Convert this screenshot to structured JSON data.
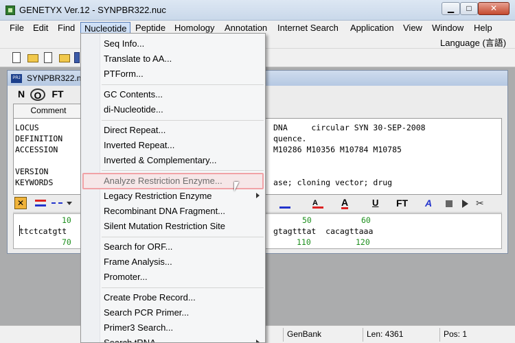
{
  "window": {
    "title": "GENETYX Ver.12 - SYNPBR322.nuc"
  },
  "menubar": {
    "items": [
      "File",
      "Edit",
      "Find",
      "Nucleotide",
      "Peptide",
      "Homology",
      "Annotation",
      "Internet Search",
      "Application",
      "View",
      "Window",
      "Help"
    ],
    "language": "Language (言語)"
  },
  "document": {
    "title": "SYNPBR322.nuc",
    "seg_buttons": [
      "N",
      "O",
      "FT"
    ],
    "comment_tab": "Comment",
    "text_lines": [
      "LOCUS",
      "DEFINITION",
      "ACCESSION",
      "",
      "VERSION",
      "KEYWORDS"
    ],
    "text_right": [
      "DNA     circular SYN 30-SEP-2008",
      "quence.",
      "M10286 M10356 M10784 M10785",
      "",
      "",
      "ase; cloning vector; drug"
    ],
    "seq_ruler1": [
      "10",
      "50",
      "60"
    ],
    "seq_left": "ttctcatgtt",
    "seq_right": "gtagtttat  cacagttaaa",
    "seq_ruler2": [
      "70",
      "110",
      "120"
    ]
  },
  "dropdown": {
    "items": [
      {
        "label": "Seq Info..."
      },
      {
        "label": "Translate to AA..."
      },
      {
        "label": "PTForm..."
      },
      {
        "label": "GC Contents..."
      },
      {
        "label": "di-Nucleotide..."
      },
      {
        "label": "Direct Repeat..."
      },
      {
        "label": "Inverted Repeat..."
      },
      {
        "label": "Inverted & Complementary..."
      },
      {
        "label": "Analyze Restriction Enzyme..."
      },
      {
        "label": "Legacy Restriction Enzyme"
      },
      {
        "label": "Recombinant DNA Fragment..."
      },
      {
        "label": "Silent Mutation Restriction Site"
      },
      {
        "label": "Search for ORF..."
      },
      {
        "label": "Frame Analysis..."
      },
      {
        "label": "Promoter..."
      },
      {
        "label": "Create Probe Record..."
      },
      {
        "label": "Search PCR Primer..."
      },
      {
        "label": "Primer3 Search..."
      },
      {
        "label": "Search tRNA"
      }
    ]
  },
  "statusbar": {
    "format": "GenBank",
    "length": "Len: 4361",
    "position": "Pos: 1"
  },
  "colors": {
    "highlight_border": "#f1a2a6",
    "menu_active": "#cfe0f6",
    "ruler": "#1d8f1d"
  }
}
